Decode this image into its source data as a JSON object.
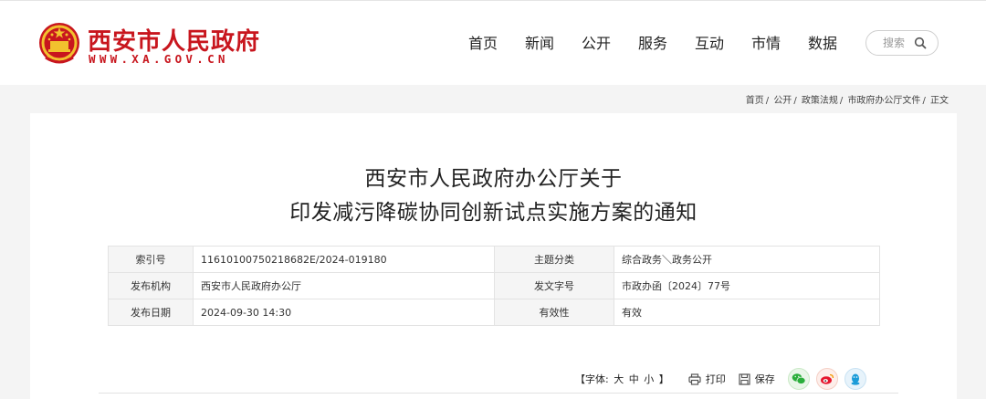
{
  "header": {
    "site_title": "西安市人民政府",
    "site_url": "WWW.XA.GOV.CN",
    "nav": [
      "首页",
      "新闻",
      "公开",
      "服务",
      "互动",
      "市情",
      "数据"
    ],
    "search_placeholder": "搜索"
  },
  "breadcrumb": {
    "items": [
      "首页",
      "公开",
      "政策法规",
      "市政府办公厅文件",
      "正文"
    ],
    "separator": "/"
  },
  "document": {
    "title_line1": "西安市人民政府办公厅关于",
    "title_line2": "印发减污降碳协同创新试点实施方案的通知",
    "meta": {
      "index_label": "索引号",
      "index_value": "11610100750218682E/2024-019180",
      "topic_label": "主题分类",
      "topic_value": "综合政务＼政务公开",
      "issuer_label": "发布机构",
      "issuer_value": "西安市人民政府办公厅",
      "doc_no_label": "发文字号",
      "doc_no_value": "市政办函〔2024〕77号",
      "date_label": "发布日期",
      "date_value": "2024-09-30 14:30",
      "validity_label": "有效性",
      "validity_value": "有效"
    }
  },
  "tools": {
    "font_open": "【字体:",
    "font_large": "大",
    "font_medium": "中",
    "font_small": "小",
    "font_close": "】",
    "print_label": "打印",
    "save_label": "保存",
    "share_icons": [
      "wechat-icon",
      "weibo-icon",
      "qq-icon"
    ]
  },
  "colors": {
    "brand_red": "#c8161e",
    "emblem_gold": "#f2c12e",
    "wechat_green": "#2aae3b",
    "weibo_red": "#e6162d",
    "qq_blue": "#1b9bd8"
  }
}
